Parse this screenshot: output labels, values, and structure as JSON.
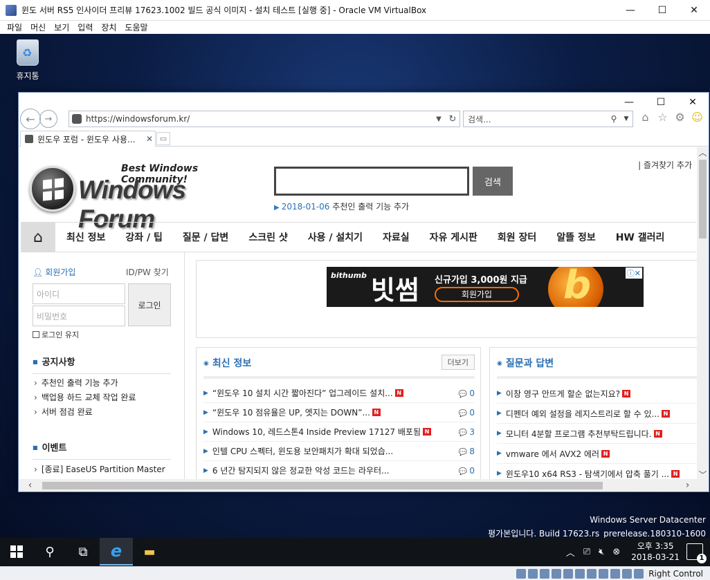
{
  "host": {
    "title": "윈도 서버 RS5 인사이더 프리뷰 17623.1002 빌드 공식 이미지 - 설치 테스트  [실행 중] - Oracle VM VirtualBox",
    "menu": [
      "파일",
      "머신",
      "보기",
      "입력",
      "장치",
      "도움말"
    ],
    "status_host_key": "Right Control"
  },
  "desktop": {
    "recycle_bin_label": "휴지통",
    "server_edition": "Windows Server Datacenter",
    "build_info": "평가본입니다. Build 17623.rs_prerelease.180310-1600"
  },
  "taskbar": {
    "time": "오후 3:35",
    "date": "2018-03-21",
    "notification_count": "1"
  },
  "browser": {
    "url": "https://windowsforum.kr/",
    "search_placeholder": "검색...",
    "tab_title": "윈도우 포럼 - 윈도우 사용..."
  },
  "site": {
    "tagline": "Best Windows Community!",
    "logo_name": "Windows Forum",
    "search_button": "검색",
    "notice_date": "2018-01-06",
    "notice_text": "추천인 출력 기능 추가",
    "favorite_add": "| 즐겨찾기 추가",
    "nav": [
      "최신 정보",
      "강좌 / 팁",
      "질문 / 답변",
      "스크린 샷",
      "사용 / 설치기",
      "자료실",
      "자유 게시판",
      "회원 장터",
      "알뜰 정보",
      "HW 갤러리"
    ],
    "login": {
      "join": "회원가입",
      "find": "ID/PW 찾기",
      "id_placeholder": "아이디",
      "pw_placeholder": "비밀번호",
      "button": "로그인",
      "keep": "로그인 유지"
    },
    "notices_title": "공지사항",
    "notices": [
      "추천인 출력 기능 추가",
      "백업용 하드 교체 작업 완료",
      "서버 점검 완료"
    ],
    "events_title": "이벤트",
    "events": [
      "[종료] EaseUS Partition Master"
    ],
    "ad": {
      "brand": "bithumb",
      "big": "빗썸",
      "sub": "신규가입 3,000원 지급",
      "cta": "회원가입"
    },
    "latest": {
      "title": "최신 정보",
      "more": "더보기",
      "items": [
        {
          "text": "“윈도우 10 설치 시간 짧아진다” 업그레이드 설치...",
          "count": "0"
        },
        {
          "text": "“윈도우 10 점유율은 UP, 엣지는 DOWN”...",
          "count": "0"
        },
        {
          "text": "Windows 10, 레드스톤4 Inside Preview 17127 배포됨",
          "count": "3"
        },
        {
          "text": "인텔 CPU 스펙터, 윈도용 보안패치가 확대 되었습...",
          "count": "8"
        },
        {
          "text": "6 년간 탐지되지 않은 정교한 악성 코드는 라우터...",
          "count": "0"
        }
      ]
    },
    "qna": {
      "title": "질문과 답변",
      "items": [
        {
          "text": "이창 영구 안뜨게 할순 없는지요?"
        },
        {
          "text": "디펜더 예외 설정을 레지스트리로 할 수 있..."
        },
        {
          "text": "모니터 4분할 프로그램 추천부탁드립니다."
        },
        {
          "text": "vmware 에서 AVX2 에러"
        },
        {
          "text": "윈도우10 x64 RS3 - 탐색기에서 압축 풀기 ..."
        }
      ]
    }
  }
}
